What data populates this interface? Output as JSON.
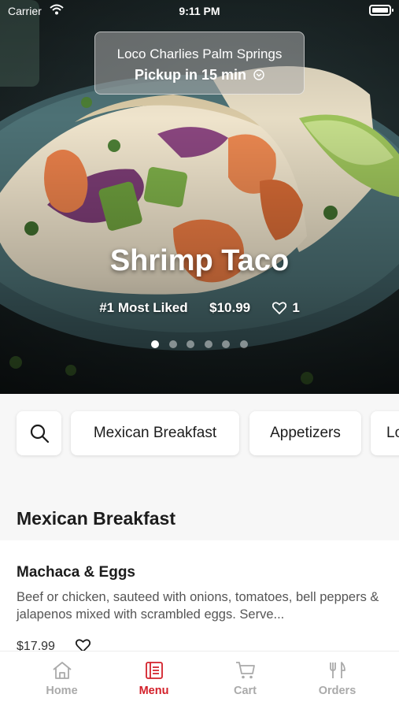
{
  "status_bar": {
    "carrier": "Carrier",
    "time": "9:11 PM"
  },
  "location": {
    "name": "Loco Charlies Palm Springs",
    "pickup": "Pickup in 15 min"
  },
  "featured": {
    "title": "Shrimp Taco",
    "badge": "#1 Most Liked",
    "price": "$10.99",
    "likes": "1",
    "active_slide": 1,
    "total_slides": 6
  },
  "categories": [
    "Mexican Breakfast",
    "Appetizers",
    "Lo"
  ],
  "section": {
    "title": "Mexican Breakfast",
    "items": [
      {
        "name": "Machaca & Eggs",
        "description": "Beef or chicken, sauteed with onions, tomatoes, bell peppers & jalapenos mixed with scrambled eggs. Serve...",
        "price": "$17.99"
      }
    ]
  },
  "tabs": [
    {
      "label": "Home",
      "icon": "home-icon"
    },
    {
      "label": "Menu",
      "icon": "menu-icon"
    },
    {
      "label": "Cart",
      "icon": "cart-icon"
    },
    {
      "label": "Orders",
      "icon": "orders-icon"
    }
  ],
  "active_tab": "Menu",
  "colors": {
    "accent": "#d3202a",
    "inactive_tab": "#aaaaaa",
    "background": "#f7f7f7"
  }
}
